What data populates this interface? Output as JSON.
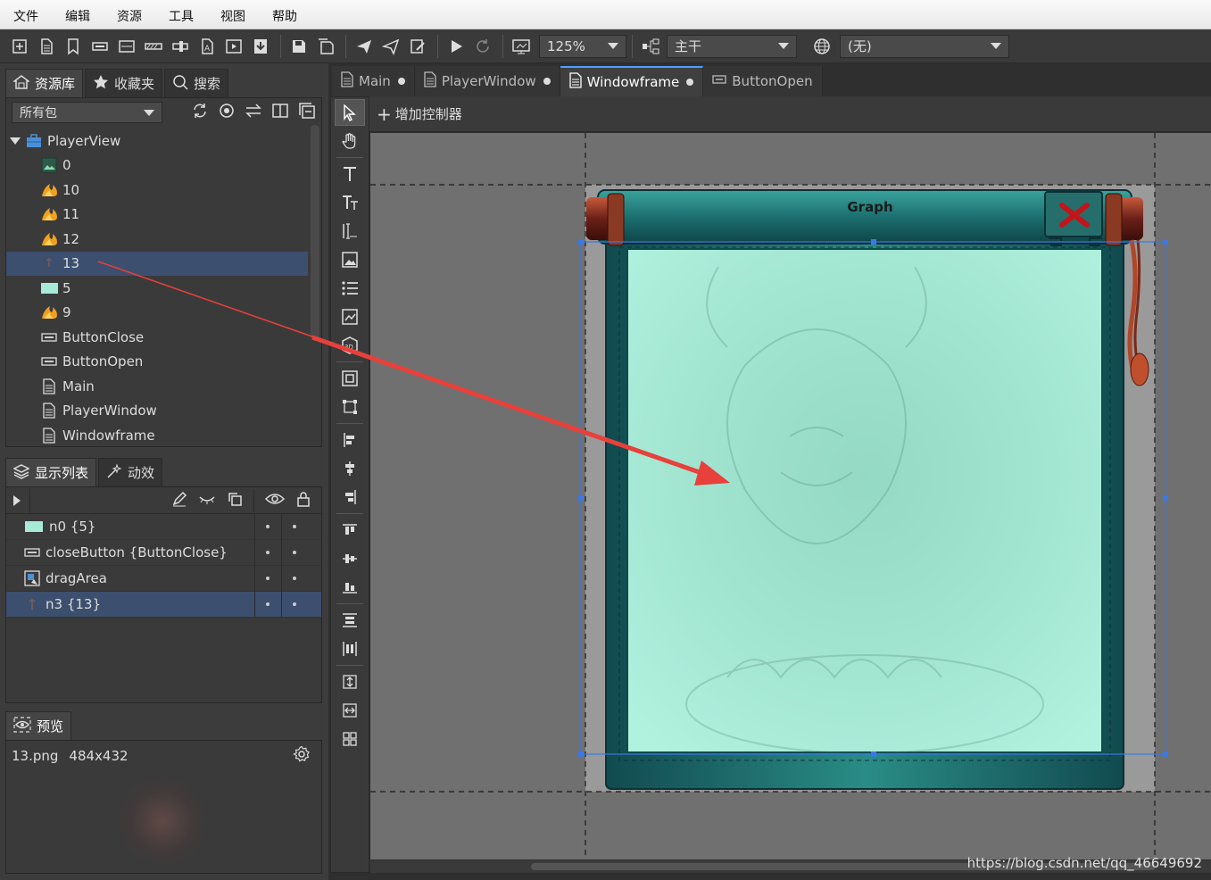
{
  "menu": [
    "文件",
    "编辑",
    "资源",
    "工具",
    "视图",
    "帮助"
  ],
  "toolbar": {
    "zoom": "125%",
    "branch": "主干",
    "language": "(无)"
  },
  "library": {
    "tabs": [
      "资源库",
      "收藏夹",
      "搜索"
    ],
    "package_filter": "所有包",
    "root": "PlayerView",
    "items": [
      {
        "label": "0",
        "icon": "image-icon"
      },
      {
        "label": "10",
        "icon": "fire-image-icon"
      },
      {
        "label": "11",
        "icon": "fire-image-icon"
      },
      {
        "label": "12",
        "icon": "fire-image-icon"
      },
      {
        "label": "13",
        "icon": "image-icon"
      },
      {
        "label": "5",
        "icon": "image-icon"
      },
      {
        "label": "9",
        "icon": "fire-image-icon"
      },
      {
        "label": "ButtonClose",
        "icon": "button-component-icon"
      },
      {
        "label": "ButtonOpen",
        "icon": "button-component-icon"
      },
      {
        "label": "Main",
        "icon": "document-icon"
      },
      {
        "label": "PlayerWindow",
        "icon": "document-icon"
      },
      {
        "label": "Windowframe",
        "icon": "document-icon"
      }
    ],
    "selected_item": "13"
  },
  "display_list": {
    "tabs": [
      "显示列表",
      "动效"
    ],
    "rows": [
      "n0 {5}",
      "closeButton {ButtonClose}",
      "dragArea",
      "n3 {13}"
    ],
    "selected_row": "n3 {13}"
  },
  "preview": {
    "tab": "预览",
    "file": "13.png",
    "size": "484x432"
  },
  "documents": {
    "tabs": [
      "Main",
      "PlayerWindow",
      "Windowframe",
      "ButtonOpen"
    ],
    "active": "Windowframe"
  },
  "canvas": {
    "add_controller": "增加控制器",
    "window_title": "Graph"
  },
  "watermark": "https://blog.csdn.net/qq_46649692",
  "colors": {
    "selection": "#3d4f6e",
    "accent": "#4aa0ff",
    "arrow": "#e8403a",
    "frame_teal": "#1f7d7a",
    "content_mint": "#a6ead7"
  }
}
